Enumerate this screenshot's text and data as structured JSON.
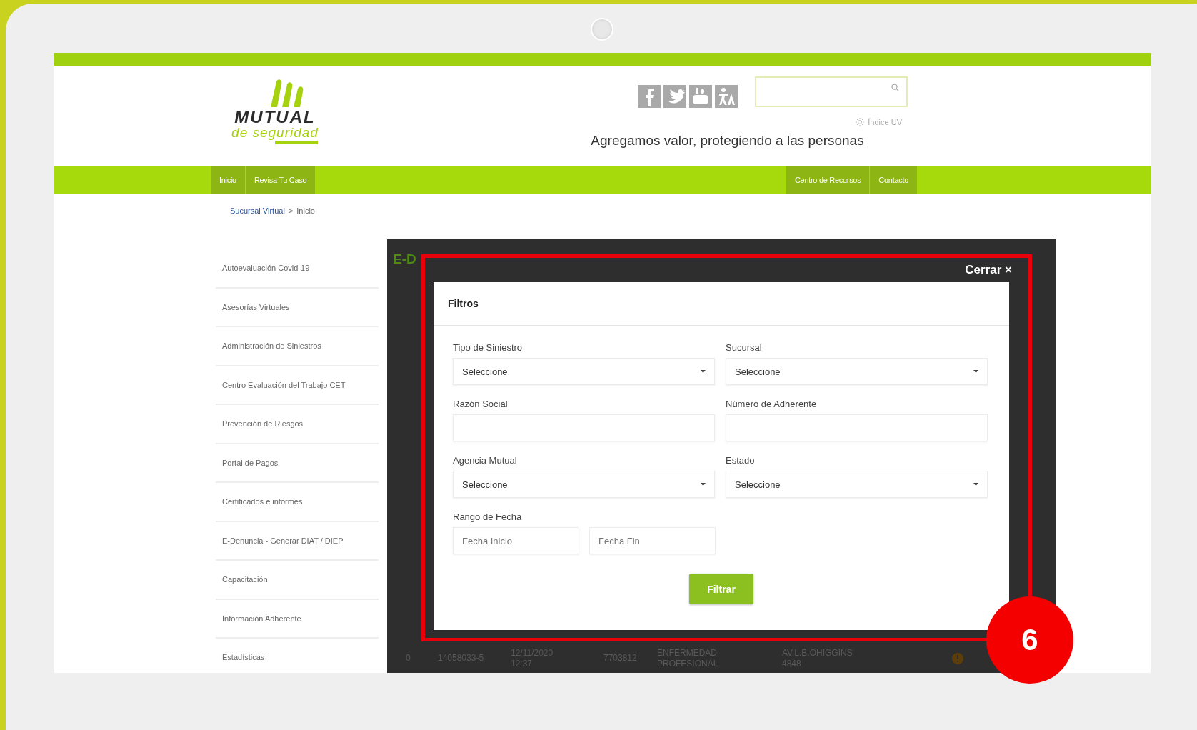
{
  "header": {
    "logo": {
      "name": "MUTUAL",
      "tagline": "de seguridad"
    },
    "uv_index": "Índice UV",
    "slogan": "Agregamos valor, protegiendo a las personas"
  },
  "nav": {
    "left": [
      "Inicio",
      "Revisa Tu Caso"
    ],
    "right": [
      "Centro de Recursos",
      "Contacto"
    ]
  },
  "breadcrumb": {
    "link": "Sucursal Virtual",
    "separator": ">",
    "current": "Inicio"
  },
  "sidebar": {
    "items": [
      "Autoevaluación Covid-19",
      "Asesorías Virtuales",
      "Administración de Siniestros",
      "Centro Evaluación del Trabajo CET",
      "Prevención de Riesgos",
      "Portal de Pagos",
      "Certificados e informes",
      "E-Denuncia - Generar DIAT / DIEP",
      "Capacitación",
      "Información Adherente",
      "Estadísticas"
    ]
  },
  "panel": {
    "title_fragment": "E-D",
    "rows": [
      {
        "cells": [
          "0",
          "14058033-5",
          "12/11/2020 12:37",
          "7703812",
          "ENFERMEDAD PROFESIONAL",
          "AV.L.B.OHIGGINS 4848"
        ]
      }
    ]
  },
  "modal": {
    "close": "Cerrar ×",
    "title": "Filtros",
    "fields": [
      {
        "kind": "select",
        "label": "Tipo de Siniestro",
        "value": "Seleccione"
      },
      {
        "kind": "select",
        "label": "Sucursal",
        "value": "Seleccione"
      },
      {
        "kind": "text",
        "label": "Razón Social"
      },
      {
        "kind": "text",
        "label": "Número de Adherente"
      },
      {
        "kind": "select",
        "label": "Agencia Mutual",
        "value": "Seleccione"
      },
      {
        "kind": "select",
        "label": "Estado",
        "value": "Seleccione"
      },
      {
        "kind": "date-range",
        "label": "Rango de Fecha",
        "placeholders": [
          "Fecha Inicio",
          "Fecha Fin"
        ]
      }
    ],
    "button": "Filtrar"
  },
  "step_badge": "6"
}
